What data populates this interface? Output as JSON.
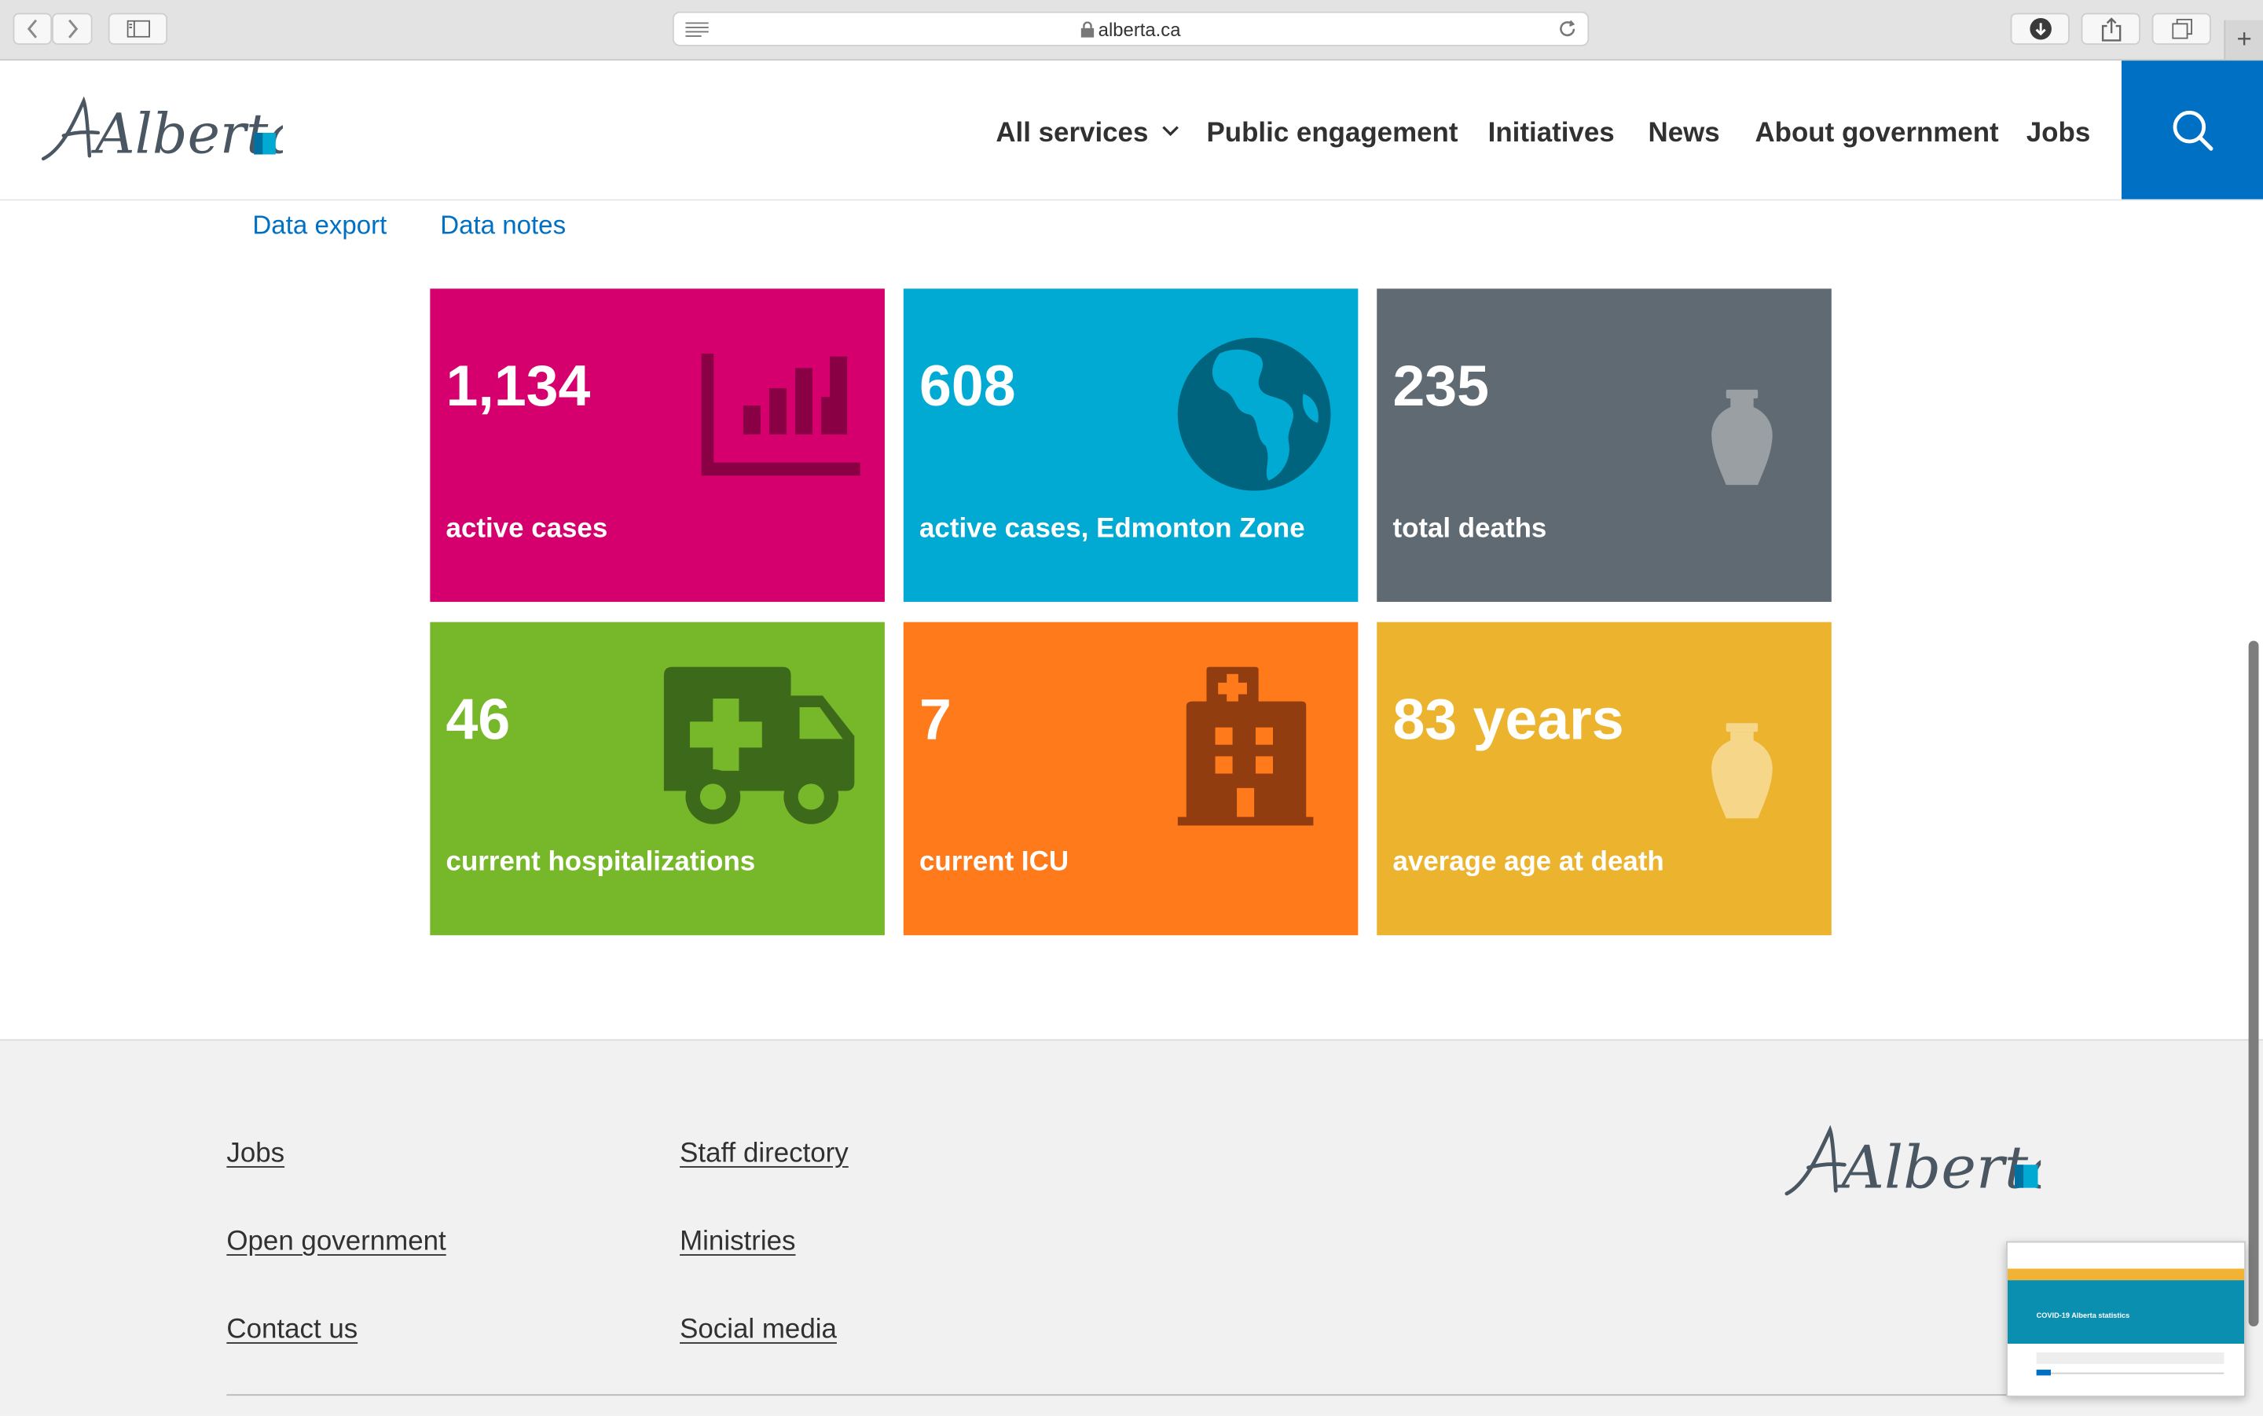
{
  "browser": {
    "url": "alberta.ca",
    "newtab_label": "+"
  },
  "header": {
    "logo_text": "Alberta",
    "nav": [
      "All services",
      "Public engagement",
      "Initiatives",
      "News",
      "About government",
      "Jobs"
    ]
  },
  "sublinks": [
    "Data export",
    "Data notes"
  ],
  "tiles": [
    {
      "value": "1,134",
      "label": "active cases",
      "color": "#d5006d",
      "icon": "bar-chart-icon"
    },
    {
      "value": "608",
      "label": "active cases, Edmonton Zone",
      "color": "#00aad2",
      "icon": "globe-icon"
    },
    {
      "value": "235",
      "label": "total deaths",
      "color": "#5f6a72",
      "icon": "urn-icon"
    },
    {
      "value": "46",
      "label": "current hospitalizations",
      "color": "#77b82a",
      "icon": "ambulance-icon"
    },
    {
      "value": "7",
      "label": "current ICU",
      "color": "#ff7a1a",
      "icon": "hospital-icon"
    },
    {
      "value": "83 years",
      "label": "average age at death",
      "color": "#ecb42e",
      "icon": "urn-icon"
    }
  ],
  "footer": {
    "col1": [
      "Jobs",
      "Open government",
      "Contact us"
    ],
    "col2": [
      "Staff directory",
      "Ministries",
      "Social media"
    ],
    "logo_text": "Alberta"
  },
  "thumbnail": {
    "title": "COVID-19 Alberta statistics"
  },
  "colors": {
    "brand_blue": "#0070c4",
    "logo_teal": "#00aad2"
  }
}
